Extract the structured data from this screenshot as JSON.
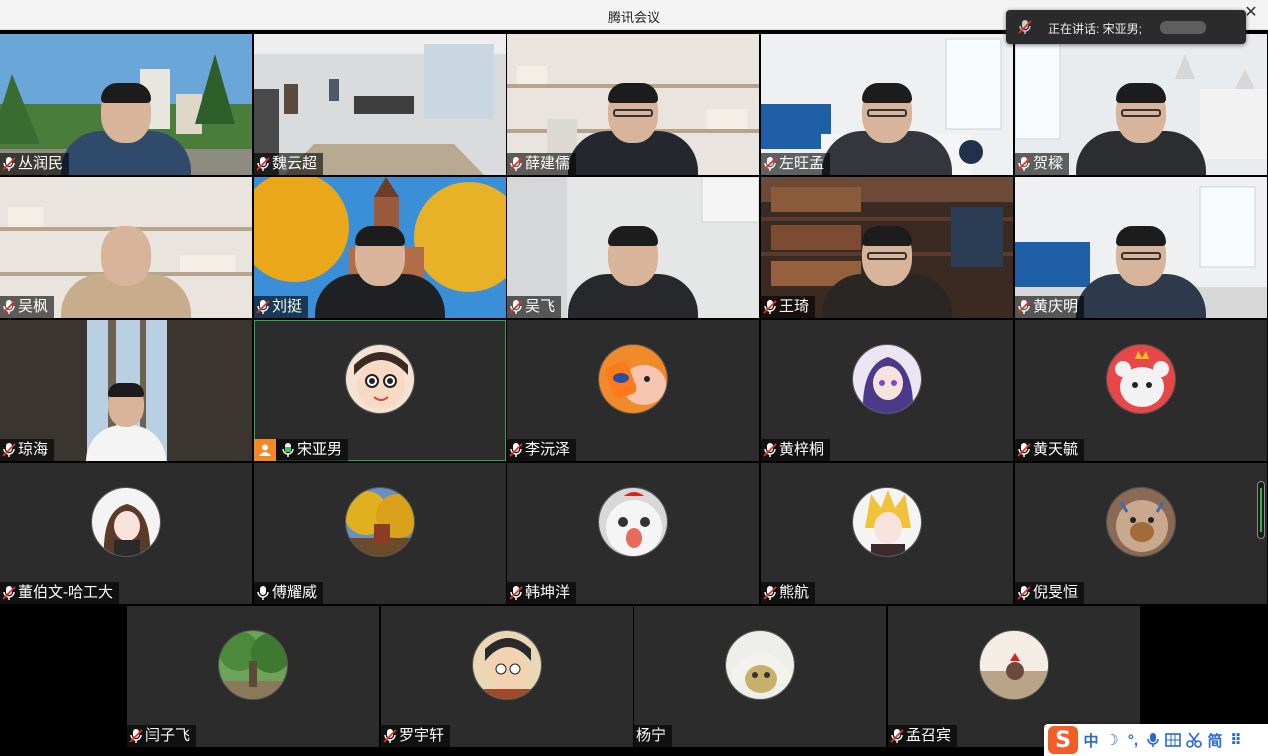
{
  "window": {
    "title": "腾讯会议",
    "close_glyph": "✕"
  },
  "speaking": {
    "text": "正在讲话: 宋亚男;"
  },
  "participants": [
    {
      "name": "丛润民"
    },
    {
      "name": "魏云超"
    },
    {
      "name": "薛建儒"
    },
    {
      "name": "左旺孟"
    },
    {
      "name": "贺樑"
    },
    {
      "name": "吴枫"
    },
    {
      "name": "刘挺"
    },
    {
      "name": "吴飞"
    },
    {
      "name": "王琦"
    },
    {
      "name": "黄庆明"
    },
    {
      "name": "琼海"
    },
    {
      "name": "宋亚男"
    },
    {
      "name": "李沅泽"
    },
    {
      "name": "黄梓桐"
    },
    {
      "name": "黄天毓"
    },
    {
      "name": "董伯文-哈工大"
    },
    {
      "name": "傅耀威"
    },
    {
      "name": "韩坤洋"
    },
    {
      "name": "熊航"
    },
    {
      "name": "倪旻恒"
    },
    {
      "name": "闫子飞"
    },
    {
      "name": "罗宇轩"
    },
    {
      "name": "杨宁"
    },
    {
      "name": "孟召宾"
    }
  ],
  "ime": {
    "logo": "S",
    "lang": "中",
    "moon": "☽",
    "punct": "°,",
    "mic": "mic-icon",
    "grid": "keyboard-icon",
    "tools": "scissors-icon",
    "mode": "简",
    "more": "grid-icon",
    "more_glyph": "⠿"
  }
}
